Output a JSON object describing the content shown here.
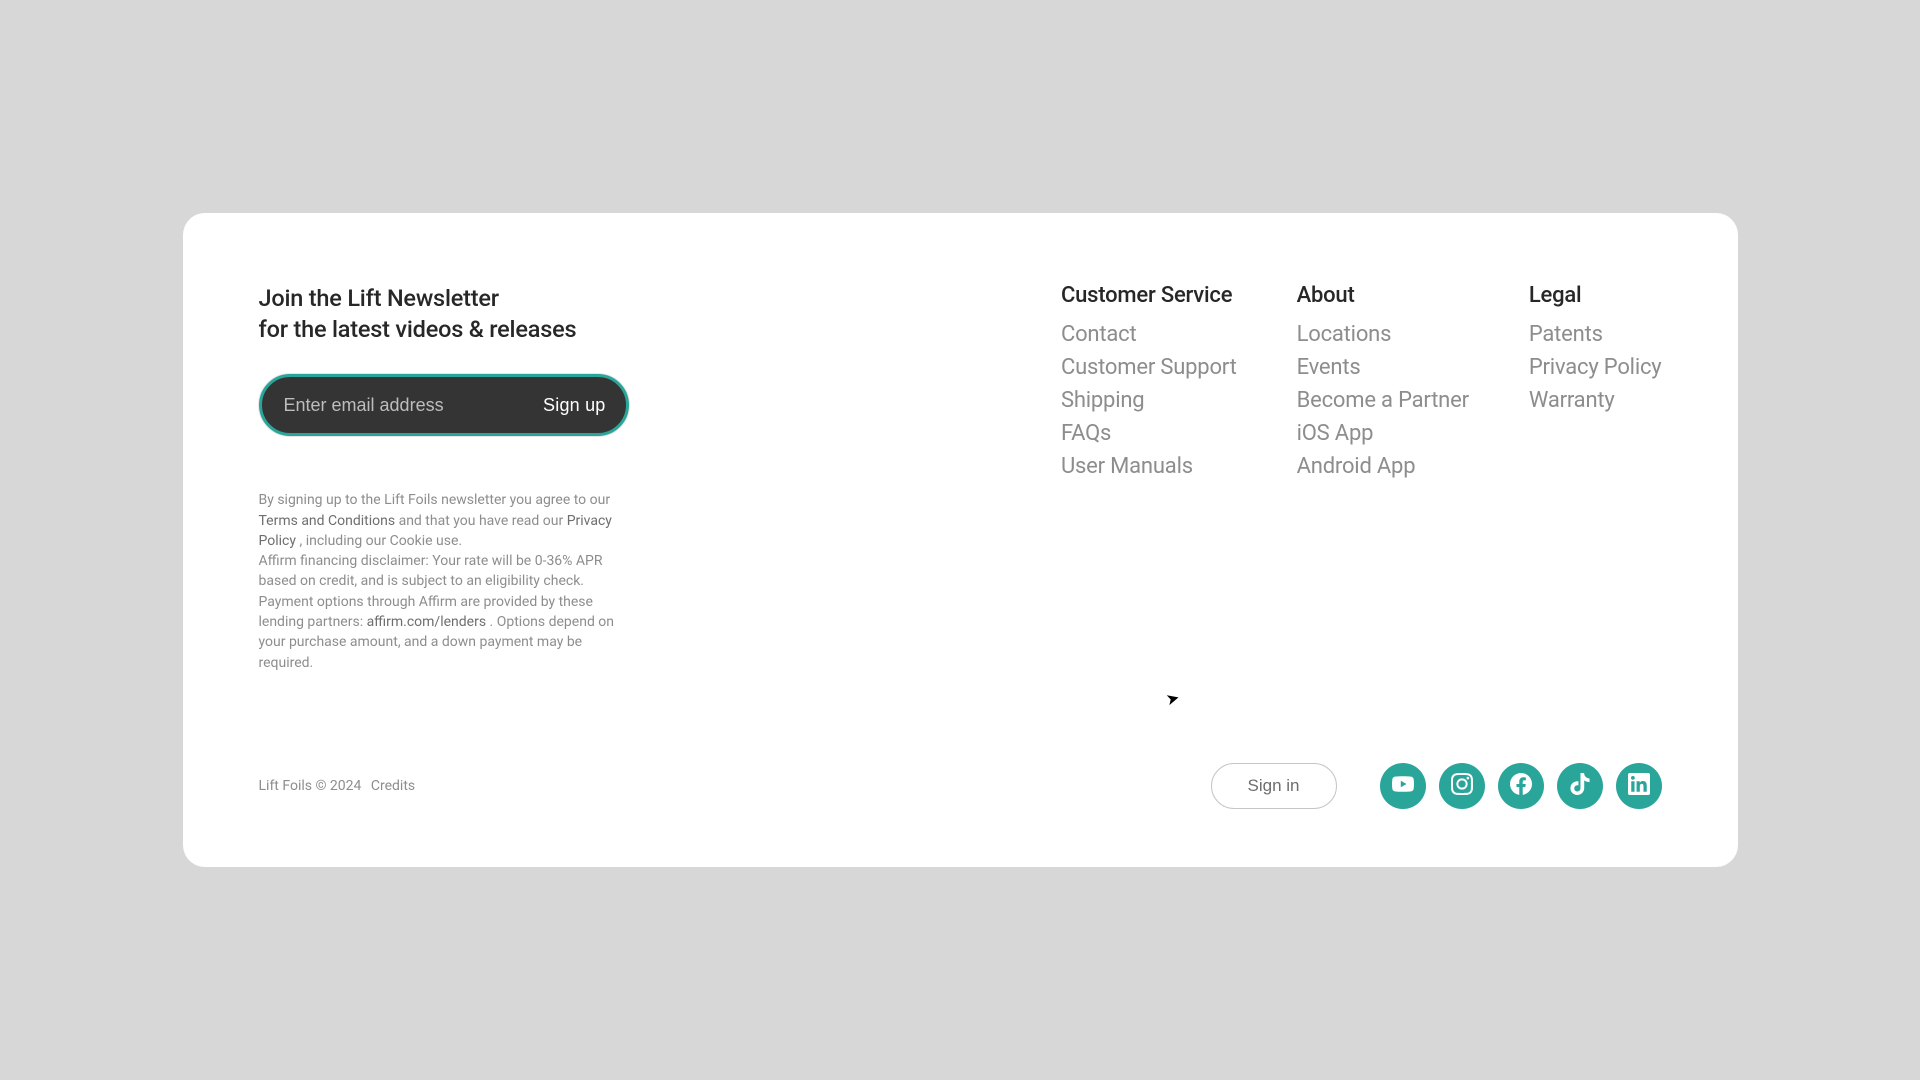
{
  "newsletter": {
    "heading_line1": "Join the Lift Newsletter",
    "heading_line2": "for the latest videos & releases",
    "email_placeholder": "Enter email address",
    "signup_label": "Sign up"
  },
  "disclaimer": {
    "prefix": "By signing up to the Lift Foils newsletter you agree to our ",
    "terms_label": "Terms and Conditions",
    "mid1": " and that you have read our ",
    "privacy_label": "Privacy Policy",
    "mid2": ", including our Cookie use.",
    "affirm1": "Affirm financing disclaimer: Your rate will be 0-36% APR based on credit, and is subject to an eligibility check. Payment options through Affirm are provided by these lending partners: ",
    "affirm_link": "affirm.com/lenders",
    "affirm2": ". Options depend on your purchase amount, and a down payment may be required."
  },
  "columns": {
    "customer_service": {
      "title": "Customer Service",
      "items": [
        "Contact",
        "Customer Support",
        "Shipping",
        "FAQs",
        "User Manuals"
      ]
    },
    "about": {
      "title": "About",
      "items": [
        "Locations",
        "Events",
        "Become a Partner",
        "iOS App",
        "Android App"
      ]
    },
    "legal": {
      "title": "Legal",
      "items": [
        "Patents",
        "Privacy Policy",
        "Warranty"
      ]
    }
  },
  "bottom": {
    "copyright": "Lift Foils © 2024",
    "credits_label": "Credits",
    "signin_label": "Sign in"
  },
  "social": {
    "youtube": "youtube-icon",
    "instagram": "instagram-icon",
    "facebook": "facebook-icon",
    "tiktok": "tiktok-icon",
    "linkedin": "linkedin-icon"
  },
  "colors": {
    "accent": "#2aa59a",
    "page_bg": "#d7d7d7",
    "card_bg": "#ffffff"
  }
}
